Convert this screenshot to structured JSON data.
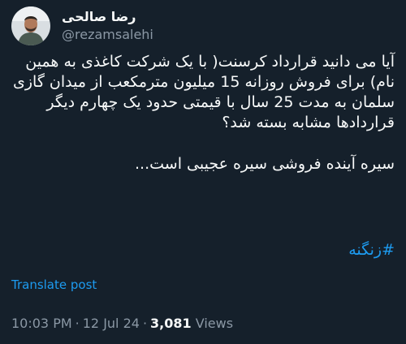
{
  "author": {
    "display_name": "رضا صالحی",
    "handle": "@rezamsalehi"
  },
  "tweet": {
    "paragraph_1": "آیا می دانید قرارداد کرسنت( با یک شرکت کاغذی به همین نام) برای فروش روزانه 15 میلیون مترمکعب از میدان گازی سلمان به مدت 25 سال با قیمتی حدود یک چهارم دیگر قراردادها مشابه بسته شد؟",
    "paragraph_2": "سیره آینده فروشی سیره عجیبی است...",
    "hashtag": "#زنگنه"
  },
  "translate_label": "Translate post",
  "meta": {
    "time": "10:03 PM",
    "separator": "·",
    "date": "12 Jul 24",
    "views_count": "3,081",
    "views_label": "Views"
  }
}
